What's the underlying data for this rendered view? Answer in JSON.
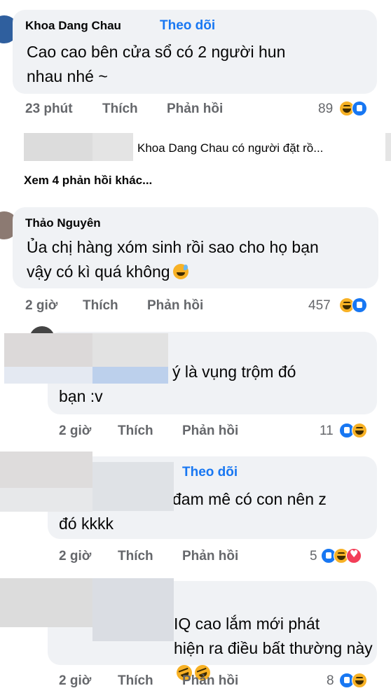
{
  "comments": [
    {
      "author": "Khoa Dang Chau",
      "follow": "Theo dõi",
      "text_lines": [
        "Cao cao bên cửa sổ có 2 người hun",
        "nhau nhé ~"
      ],
      "time": "23 phút",
      "like": "Thích",
      "reply": "Phản hồi",
      "count": "89",
      "reactions": [
        "haha",
        "like"
      ]
    },
    {
      "author": "Thảo Nguyên",
      "text_lines": [
        "Ủa chị hàng xóm sinh rồi sao cho họ bạn",
        "vậy có kì quá không"
      ],
      "emoji": "grinning-sweat",
      "time": "2 giờ",
      "like": "Thích",
      "reply": "Phản hồi",
      "count": "457",
      "reactions": [
        "haha",
        "like"
      ]
    },
    {
      "text_lines": [
        "ý là vụng trộm đó",
        "bạn :v"
      ],
      "time": "2 giờ",
      "like": "Thích",
      "reply": "Phản hồi",
      "count": "11",
      "reactions": [
        "like",
        "haha"
      ]
    },
    {
      "follow": "Theo dõi",
      "text_lines": [
        "đam mê có con nên z",
        "đó kkkk"
      ],
      "time": "2 giờ",
      "like": "Thích",
      "reply": "Phản hồi",
      "count": "5",
      "reactions": [
        "like",
        "haha",
        "love"
      ]
    },
    {
      "text_lines": [
        "IQ cao lắm mới phát",
        "hiện ra điều bất thường này"
      ],
      "emoji": "rofl",
      "time": "2 giờ",
      "like": "Thích",
      "reply": "Phản hồi",
      "count": "8",
      "reactions": [
        "like",
        "haha"
      ]
    }
  ],
  "reply_preview": "Khoa Dang Chau có người đặt rồ...",
  "more_replies": "Xem 4 phản hồi khác..."
}
